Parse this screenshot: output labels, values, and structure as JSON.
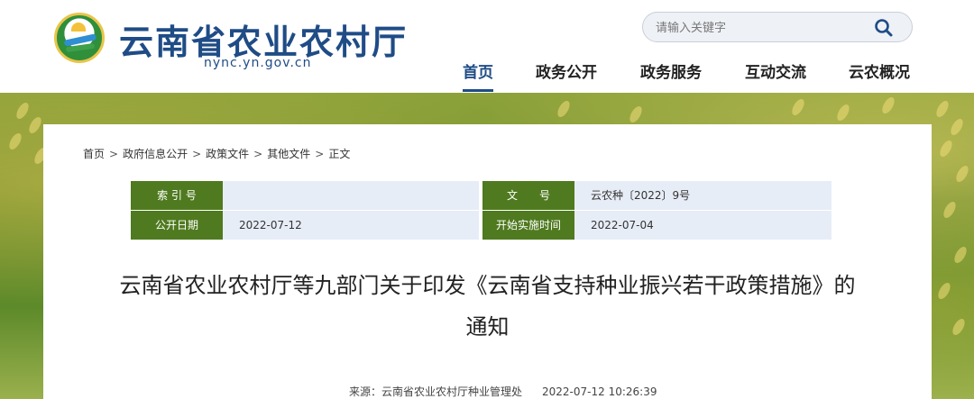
{
  "header": {
    "site_title": "云南省农业农村厅",
    "site_domain": "nync.yn.gov.cn",
    "search": {
      "placeholder": "请输入关键字"
    },
    "nav": [
      {
        "label": "首页",
        "active": true
      },
      {
        "label": "政务公开",
        "active": false
      },
      {
        "label": "政务服务",
        "active": false
      },
      {
        "label": "互动交流",
        "active": false
      },
      {
        "label": "云农概况",
        "active": false
      }
    ]
  },
  "breadcrumb": [
    "首页",
    "政府信息公开",
    "政策文件",
    "其他文件",
    "正文"
  ],
  "breadcrumb_separator": ">",
  "meta": {
    "index_no": {
      "label": "索 引 号",
      "value": ""
    },
    "doc_no": {
      "label": "文　　号",
      "value": "云农种〔2022〕9号"
    },
    "publish_date": {
      "label": "公开日期",
      "value": "2022-07-12"
    },
    "effective_date": {
      "label": "开始实施时间",
      "value": "2022-07-04"
    }
  },
  "document": {
    "title": "云南省农业农村厅等九部门关于印发《云南省支持种业振兴若干政策措施》的通知",
    "source": "来源：云南省农业农村厅种业管理处",
    "datetime": "2022-07-12 10:26:39"
  },
  "colors": {
    "brand": "#1f4c86",
    "label_bg": "#4f7a1f",
    "value_bg": "#e7edf6"
  }
}
